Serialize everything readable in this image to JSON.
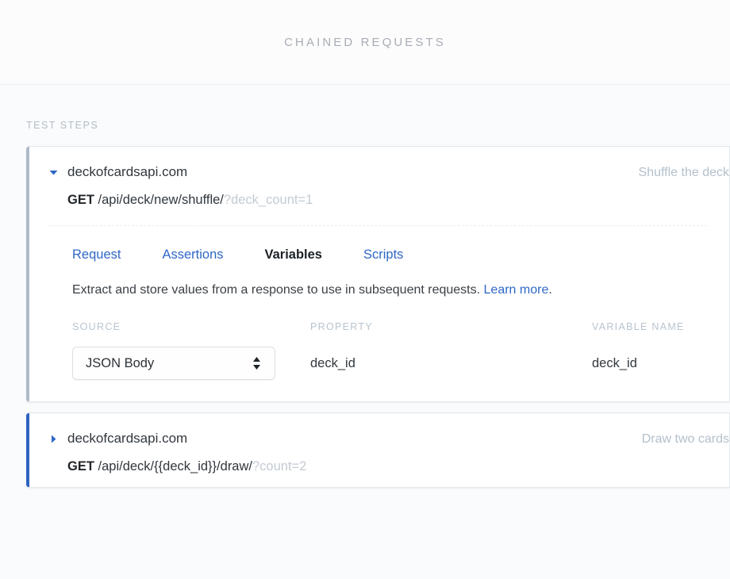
{
  "header": {
    "title": "Chained Requests"
  },
  "section": {
    "label": "Test steps"
  },
  "colors": {
    "accent_blue": "#2f68c5",
    "selected_bar": "#2f63c0",
    "idle_bar": "#aebac8",
    "muted_text": "#b3c0cc",
    "query_text": "#c3cbd3"
  },
  "steps": [
    {
      "expanded": true,
      "selected": false,
      "caret_icon": "caret-down-icon",
      "host": "deckofcardsapi.com",
      "description": "Shuffle the deck",
      "method": "GET",
      "path": "/api/deck/new/shuffle/",
      "query": "?deck_count=1",
      "tabs": [
        {
          "label": "Request",
          "active": false
        },
        {
          "label": "Assertions",
          "active": false
        },
        {
          "label": "Variables",
          "active": true
        },
        {
          "label": "Scripts",
          "active": false
        }
      ],
      "panel": {
        "description_text": "Extract and store values from a response to use in subsequent requests. ",
        "link_label": "Learn more",
        "description_suffix": ".",
        "table": {
          "columns": [
            "Source",
            "Property",
            "Variable name"
          ],
          "rows": [
            {
              "source": "JSON Body",
              "source_options": [
                "JSON Body"
              ],
              "property": "deck_id",
              "variable_name": "deck_id"
            }
          ]
        }
      }
    },
    {
      "expanded": false,
      "selected": true,
      "caret_icon": "caret-right-icon",
      "host": "deckofcardsapi.com",
      "description": "Draw two cards",
      "method": "GET",
      "path": "/api/deck/{{deck_id}}/draw/",
      "query": "?count=2"
    }
  ]
}
